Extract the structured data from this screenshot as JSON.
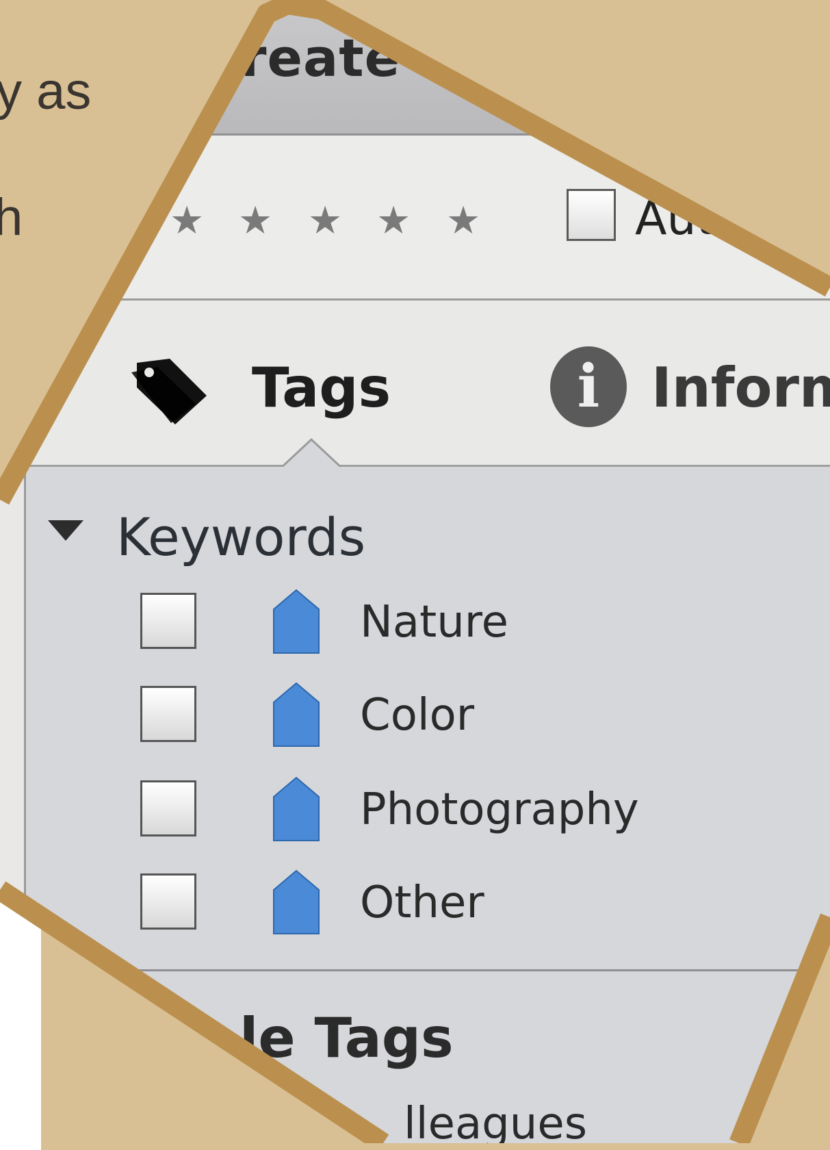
{
  "background_text": {
    "fragment_1": "y as",
    "fragment_2": "th"
  },
  "header": {
    "title": "reate"
  },
  "rating": {
    "stars": 5,
    "star_glyph": "★",
    "auto_label": "Auto"
  },
  "tabs": [
    {
      "label": "Tags",
      "icon": "tag-icon",
      "selected": true
    },
    {
      "label": "Information",
      "icon": "info-icon",
      "selected": false
    }
  ],
  "tabs_visible": {
    "tags": "Tags",
    "info": "Informa"
  },
  "keywords": {
    "title": "Keywords",
    "items": [
      {
        "label": "Nature",
        "checked": false
      },
      {
        "label": "Color",
        "checked": false
      },
      {
        "label": "Photography",
        "checked": false
      },
      {
        "label": "Other",
        "checked": false
      }
    ]
  },
  "people_tags": {
    "title": "le Tags",
    "first_item": "lleagues"
  },
  "colors": {
    "frame": "#bb904f",
    "backdrop": "#d9c094",
    "tag_blue": "#4a8ad6"
  }
}
